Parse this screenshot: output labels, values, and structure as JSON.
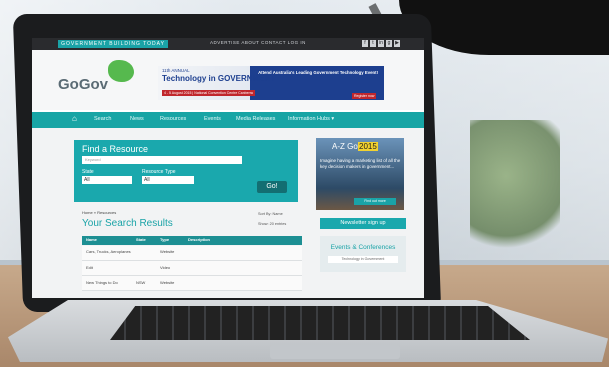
{
  "site": {
    "tagline": "GOVERNMENT BUILDING TODAY",
    "top_links": "ADVERTISE   ABOUT   CONTACT   LOG IN",
    "social_icons": [
      "facebook-icon",
      "twitter-icon",
      "linkedin-icon",
      "google-plus-icon",
      "youtube-icon"
    ],
    "logo": "GoGov"
  },
  "banner": {
    "line1": "11th ANNUAL",
    "line2": "Technology in GOVERNMENT",
    "date": "4 - 5 August 2015 | National Convention Centre Canberra",
    "right_text": "Attend Australia's Leading Government Technology Event!",
    "cta": "Register now"
  },
  "nav": {
    "items": [
      "Search",
      "News",
      "Resources",
      "Events",
      "Media Releases",
      "Information Hubs ▾"
    ]
  },
  "find": {
    "title": "Find a Resource",
    "keyword_placeholder": "Keyword",
    "state_label": "State",
    "state_value": "All",
    "type_label": "Resource Type",
    "type_value": "All",
    "go_label": "Go!"
  },
  "breadcrumb": "Home » Resources",
  "results": {
    "title": "Your Search Results",
    "sort_by": "Sort By: Name",
    "show": "Show: 20  entries",
    "columns": [
      "Name",
      "State",
      "Type",
      "Description"
    ],
    "rows": [
      {
        "name": "Cars, Trucks, Aeroplanes",
        "state": "",
        "type": "Website",
        "desc": ""
      },
      {
        "name": "Edit",
        "state": "",
        "type": "Video",
        "desc": ""
      },
      {
        "name": "New Things to Do",
        "state": "NSW",
        "type": "Website",
        "desc": ""
      }
    ]
  },
  "ad": {
    "logo_a": "A-Z Gov",
    "logo_b": "2015",
    "text": "Imagine having a marketing list of all the key decision makers in government...",
    "button": "Find out more"
  },
  "sidebar": {
    "newsletter": "Newsletter sign up",
    "events_title": "Events & Conferences",
    "events_item": "Technology in Government"
  },
  "colors": {
    "teal": "#1aa8ad",
    "dark_teal": "#136e72",
    "navy": "#1d3f8f",
    "red": "#c0272d"
  }
}
